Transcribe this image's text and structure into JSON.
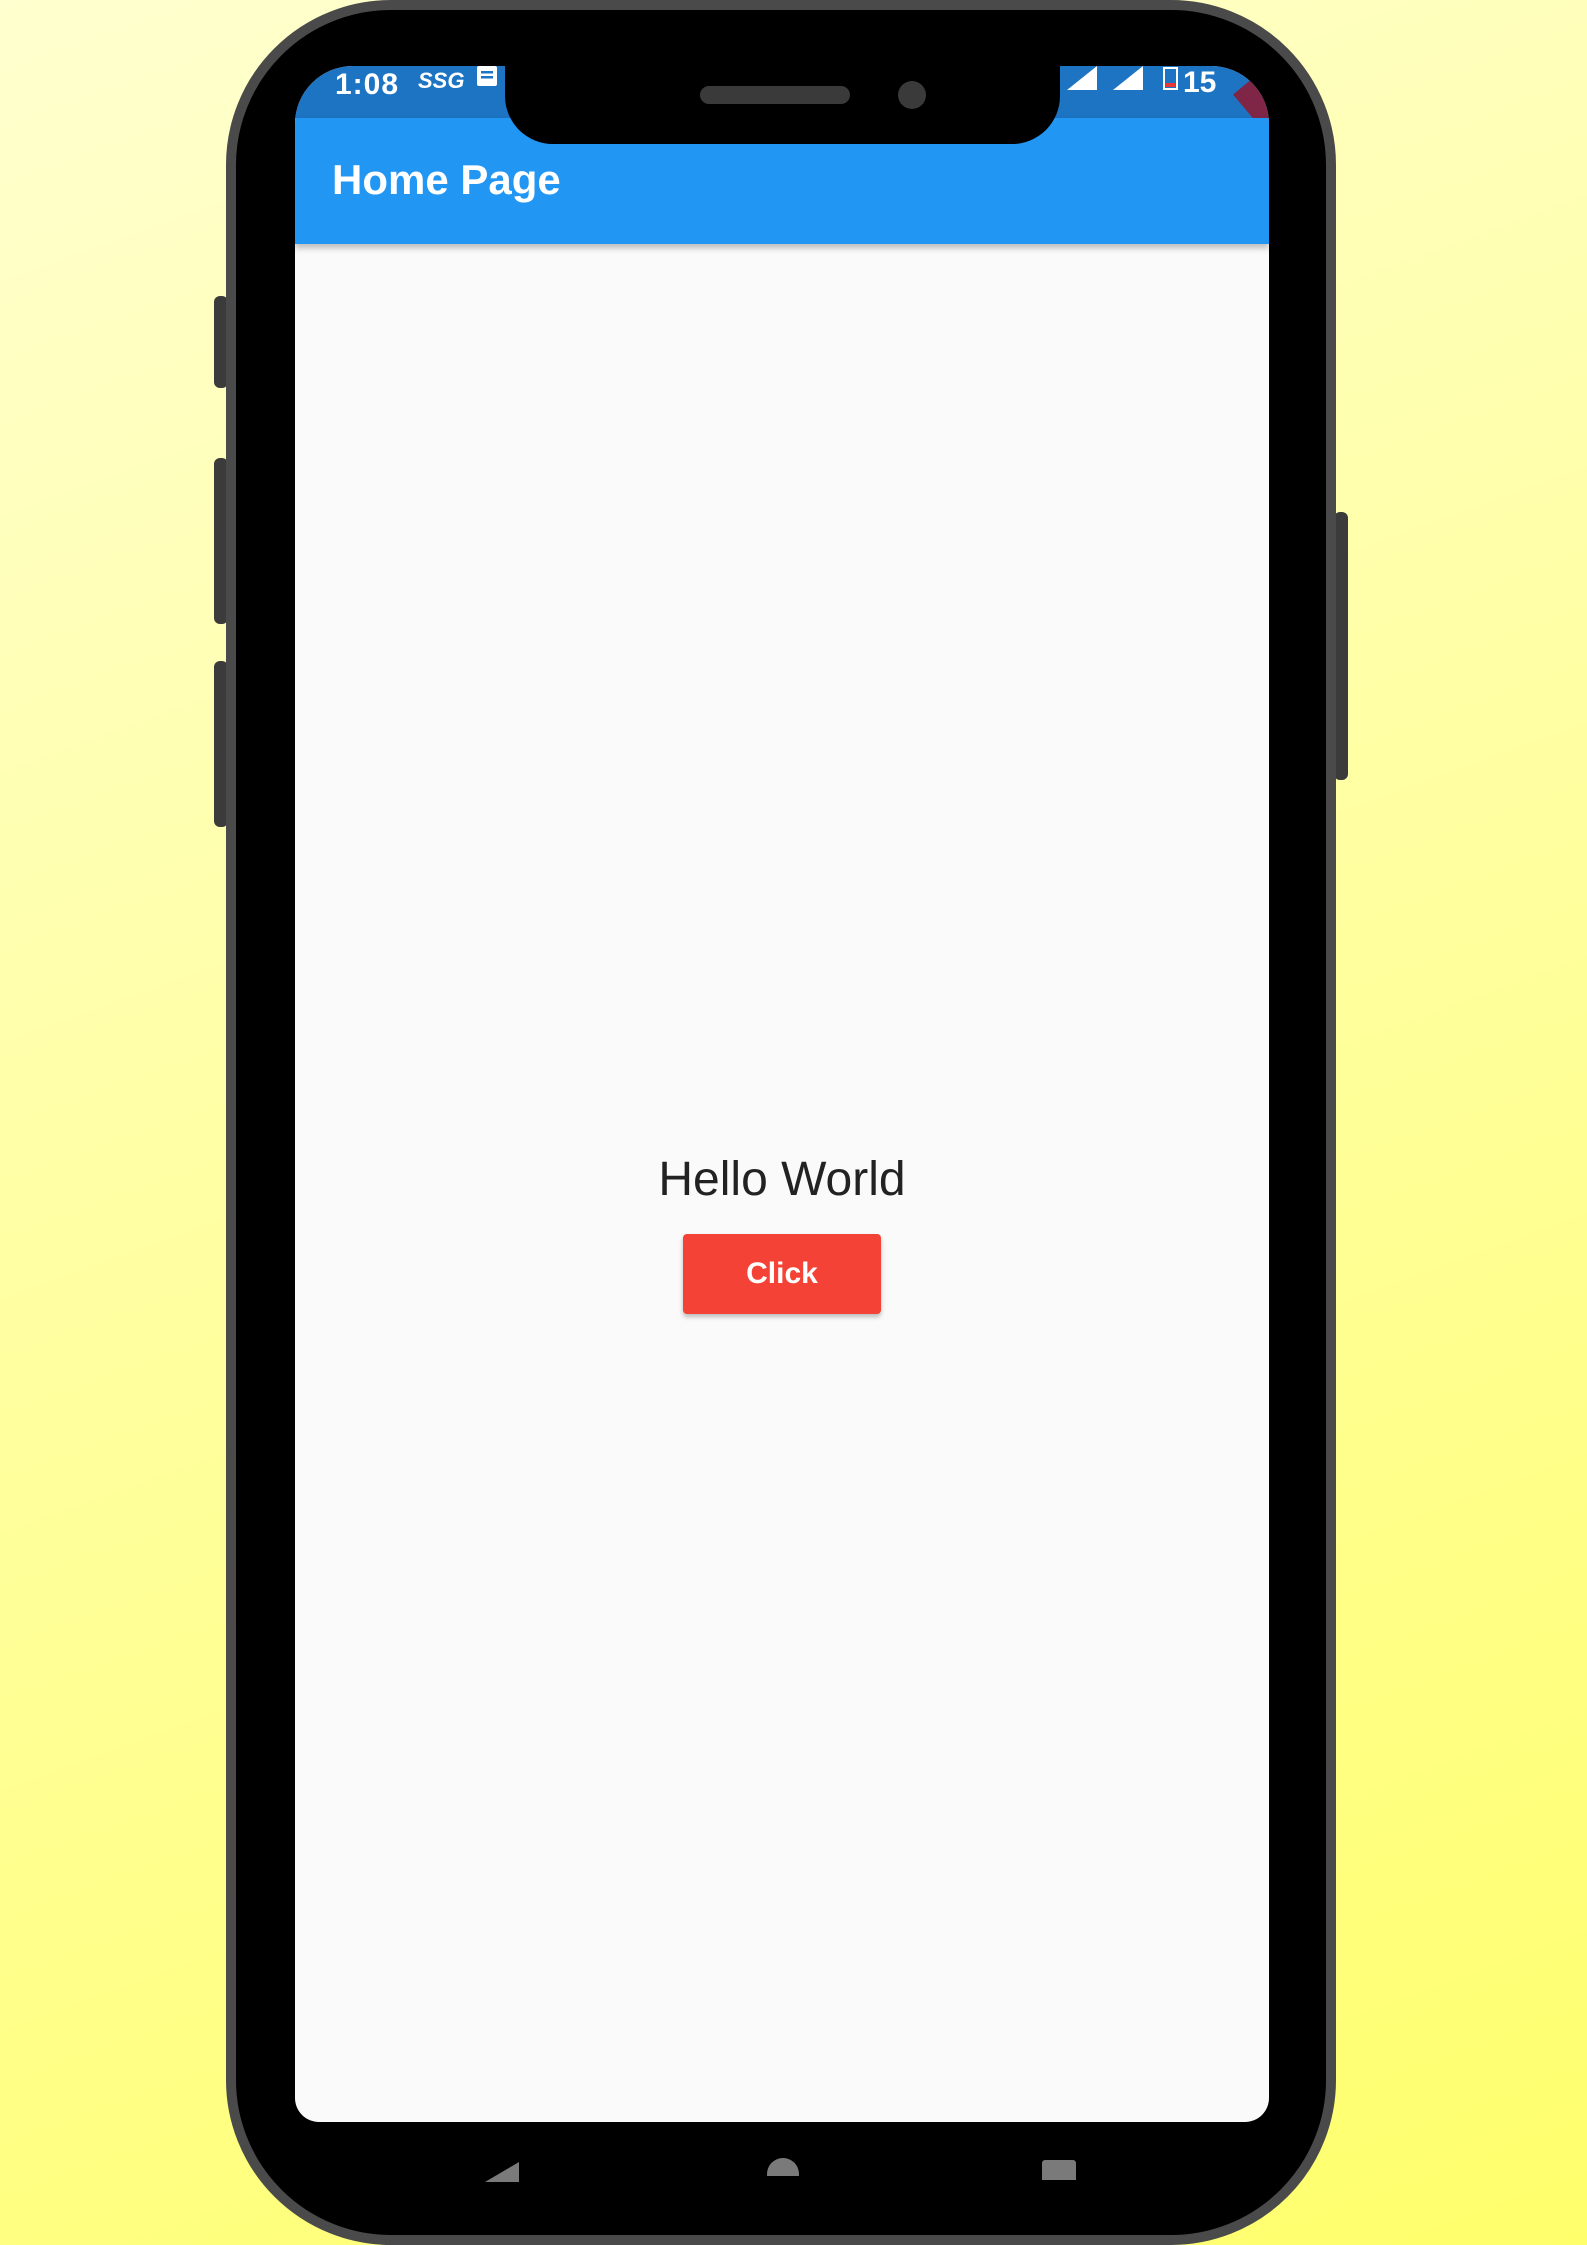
{
  "status_bar": {
    "time": "1:08",
    "carrier_tag": "SSG",
    "battery_percent": "15"
  },
  "app_bar": {
    "title": "Home Page",
    "color": "#2196f3"
  },
  "main": {
    "text": "Hello World",
    "button_label": "Click",
    "button_color": "#f44336"
  },
  "icons": {
    "status": [
      "notification-icon",
      "signal-icon",
      "signal-icon",
      "battery-icon"
    ],
    "navigation": [
      "back-icon",
      "home-icon",
      "recents-icon"
    ]
  }
}
